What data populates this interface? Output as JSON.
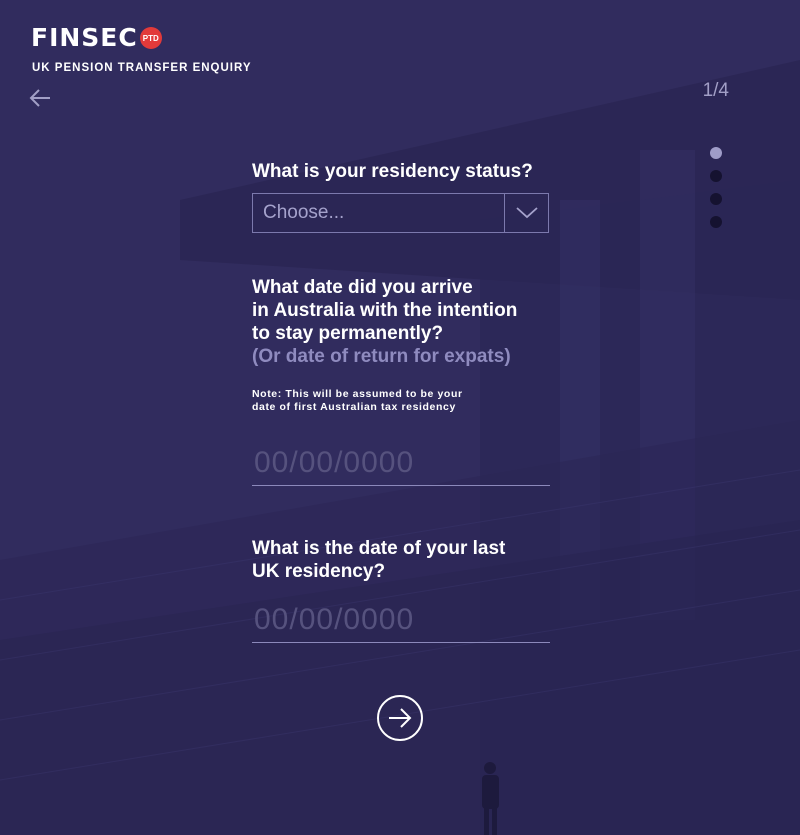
{
  "brand": {
    "name": "FINSEC",
    "badge": "PTD",
    "subtitle": "UK PENSION TRANSFER ENQUIRY"
  },
  "nav": {
    "back_icon": "arrow-left-icon",
    "step_indicator": "1/4",
    "steps_total": 4,
    "step_current": 1
  },
  "form": {
    "residency": {
      "question": "What is your residency status?",
      "select_value": "Choose..."
    },
    "arrival": {
      "question_lines": [
        "What date did you arrive",
        "in Australia with the intention",
        "to stay permanently?"
      ],
      "sub": "(Or date of return for expats)",
      "note_lines": [
        "Note: This will be assumed to be your",
        "date of first Australian tax residency"
      ],
      "placeholder": "00/00/0000"
    },
    "last_uk": {
      "question_lines": [
        "What is the date of your last",
        "UK residency?"
      ],
      "placeholder": "00/00/0000"
    }
  },
  "next_button": {
    "icon": "arrow-right-circle-icon"
  },
  "colors": {
    "background": "#312c5e",
    "muted": "#8f8bbf",
    "badge": "#e23a3a",
    "dot_active": "#9f9cc8",
    "dot_inactive": "#151230"
  }
}
